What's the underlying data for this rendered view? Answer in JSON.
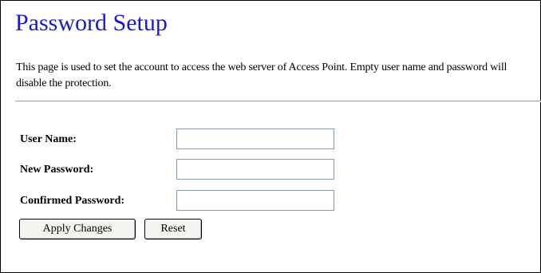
{
  "page": {
    "title": "Password Setup",
    "description": "This page is used to set the account to access the web server of Access Point. Empty user name and password will disable the protection."
  },
  "form": {
    "user_name": {
      "label": "User Name:",
      "value": ""
    },
    "new_password": {
      "label": "New Password:",
      "value": ""
    },
    "confirmed_password": {
      "label": "Confirmed Password:",
      "value": ""
    }
  },
  "buttons": {
    "apply_label": "Apply Changes",
    "reset_label": "Reset"
  },
  "colors": {
    "title": "#1a1acc",
    "input_border": "#7f9db9"
  }
}
